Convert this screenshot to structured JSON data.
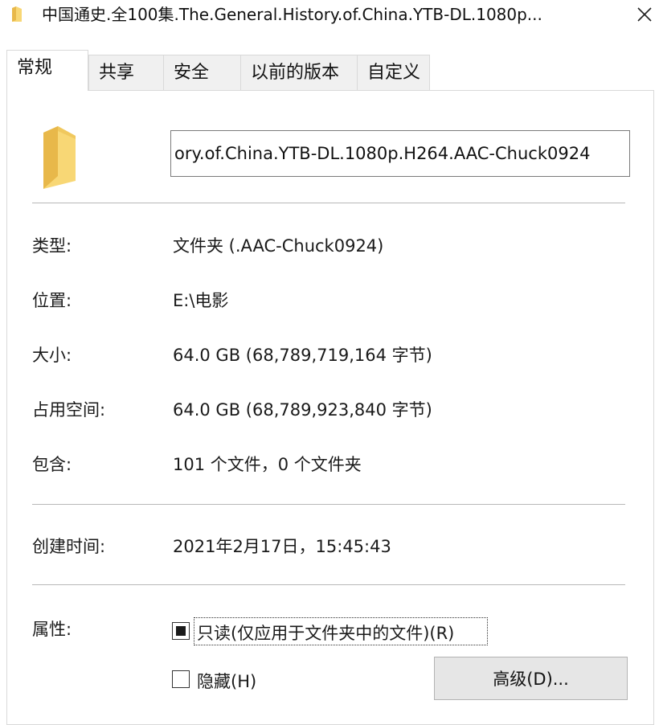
{
  "window": {
    "title": "中国通史.全100集.The.General.History.of.China.YTB-DL.1080p...",
    "close_icon": "close-icon"
  },
  "tabs": [
    "常规",
    "共享",
    "安全",
    "以前的版本",
    "自定义"
  ],
  "active_tab": "常规",
  "name_field": {
    "value": "ory.of.China.YTB-DL.1080p.H264.AAC-Chuck0924"
  },
  "properties": {
    "type_label": "类型:",
    "type_value": "文件夹 (.AAC-Chuck0924)",
    "location_label": "位置:",
    "location_value": "E:\\电影",
    "size_label": "大小:",
    "size_value": "64.0 GB (68,789,719,164 字节)",
    "disk_size_label": "占用空间:",
    "disk_size_value": "64.0 GB (68,789,923,840 字节)",
    "contains_label": "包含:",
    "contains_value": "101 个文件，0 个文件夹",
    "created_label": "创建时间:",
    "created_value": "2021年2月17日，15:45:43"
  },
  "attributes": {
    "label": "属性:",
    "readonly_label": "只读(仅应用于文件夹中的文件)(R)",
    "readonly_state": "indeterminate",
    "hidden_label": "隐藏(H)",
    "hidden_checked": false,
    "advanced_button": "高级(D)..."
  },
  "colors": {
    "folder_yellow": "#f8d775",
    "folder_dark": "#e8b84a",
    "tab_inactive_bg": "#f0f0f0",
    "button_bg": "#e6e6e6"
  }
}
